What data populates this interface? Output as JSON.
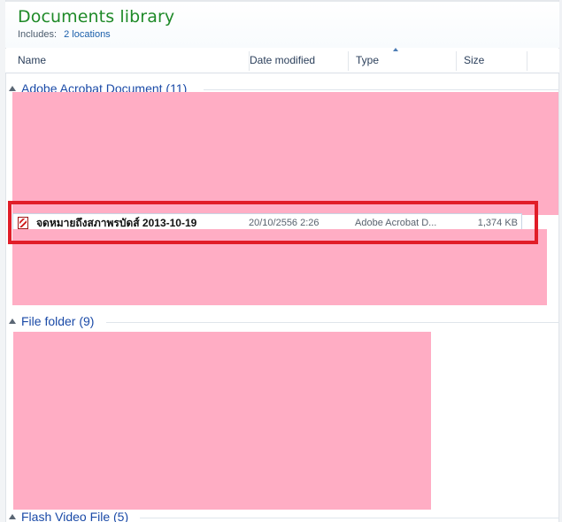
{
  "library": {
    "title": "Documents library",
    "includes_label": "Includes:",
    "includes_link": "2 locations"
  },
  "columns": {
    "name": "Name",
    "date_modified": "Date modified",
    "type": "Type",
    "size": "Size",
    "sort_icon": "sort-up-icon"
  },
  "groups": {
    "adobe": "Adobe Acrobat Document (11)",
    "folder": "File folder (9)",
    "video": "Flash Video File (5)"
  },
  "selected_file": {
    "icon": "pdf-file-icon",
    "name": "จดหมายถึงสภาพรบัดส์ 2013-10-19",
    "date_modified": "20/10/2556 2:26",
    "type": "Adobe Acrobat D...",
    "size": "1,374 KB"
  },
  "colors": {
    "library_title": "#1f8a28",
    "link": "#1b5fab",
    "group_header": "#1a4aa7",
    "redaction": "#ffadc4",
    "highlight": "#e11d28",
    "underline": "#1e2e66"
  }
}
